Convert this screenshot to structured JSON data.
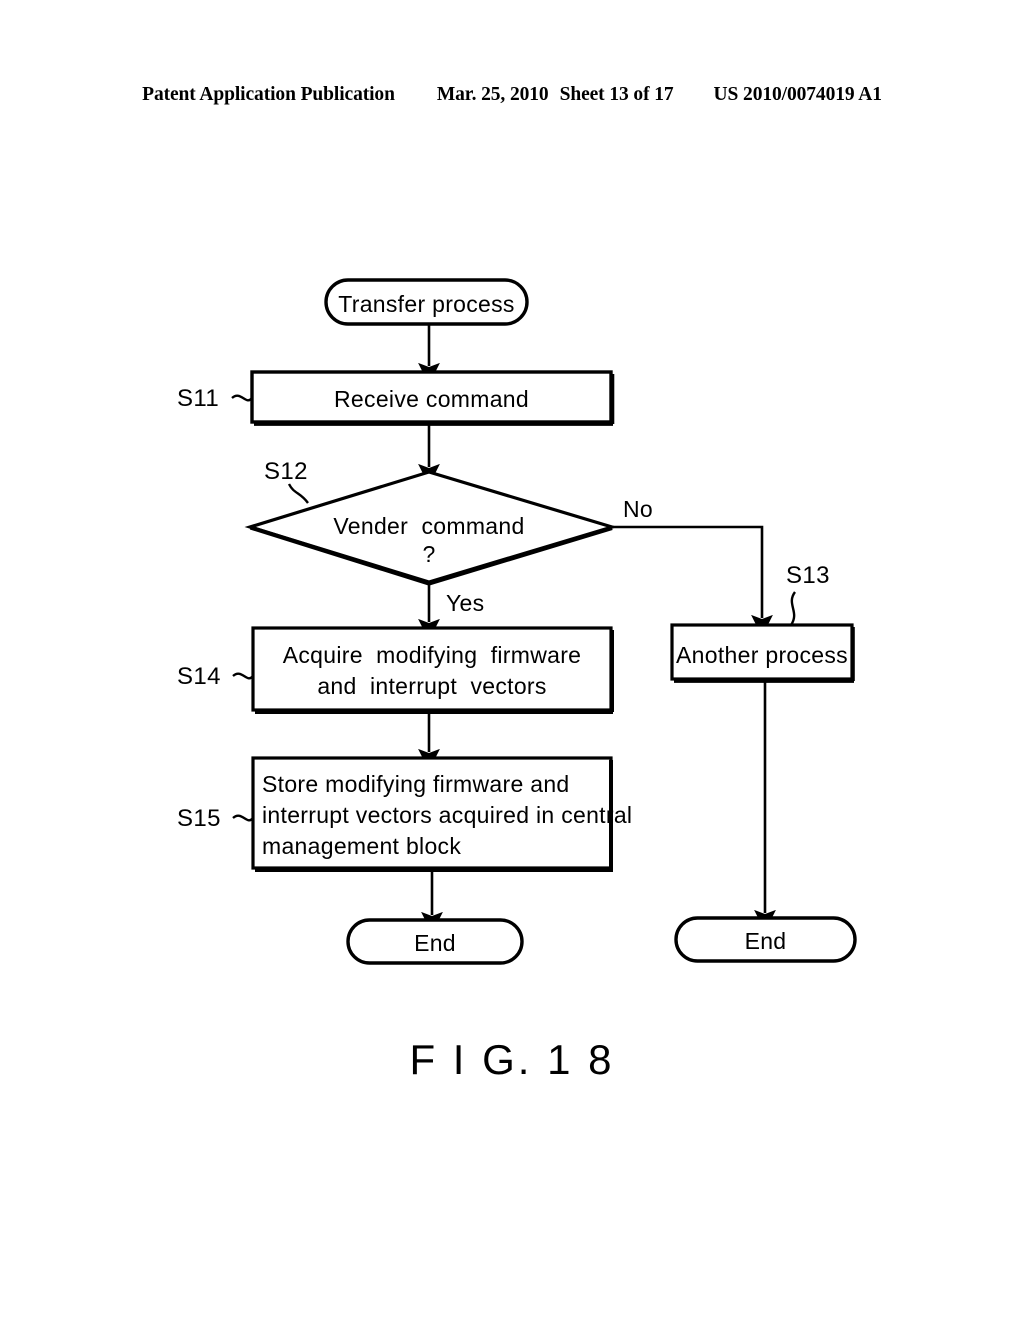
{
  "header": {
    "publication": "Patent Application Publication",
    "date": "Mar. 25, 2010",
    "sheet": "Sheet 13 of 17",
    "patent_number": "US 2010/0074019 A1"
  },
  "figure": {
    "caption": "F I G. 1 8",
    "nodes": {
      "start": {
        "id": "start",
        "shape": "terminator",
        "label": "Transfer process"
      },
      "s11": {
        "id": "S11",
        "shape": "process",
        "label": "Receive command",
        "step": "S11"
      },
      "s12": {
        "id": "S12",
        "shape": "decision",
        "label_line1": "Vender  command",
        "label_line2": "?",
        "step": "S12"
      },
      "s13": {
        "id": "S13",
        "shape": "process",
        "label": "Another process",
        "step": "S13"
      },
      "s14": {
        "id": "S14",
        "shape": "process",
        "label_line1": "Acquire  modifying  firmware",
        "label_line2": "and  interrupt  vectors",
        "step": "S14"
      },
      "s15": {
        "id": "S15",
        "shape": "process",
        "label_line1": "Store modifying firmware and",
        "label_line2": "interrupt vectors acquired in central",
        "label_line3": "management block",
        "step": "S15"
      },
      "end_left": {
        "id": "end-left",
        "shape": "terminator",
        "label": "End"
      },
      "end_right": {
        "id": "end-right",
        "shape": "terminator",
        "label": "End"
      }
    },
    "branches": {
      "yes": "Yes",
      "no": "No"
    },
    "colors": {
      "stroke": "#000000",
      "fill": "#ffffff",
      "background": "#ffffff"
    }
  }
}
